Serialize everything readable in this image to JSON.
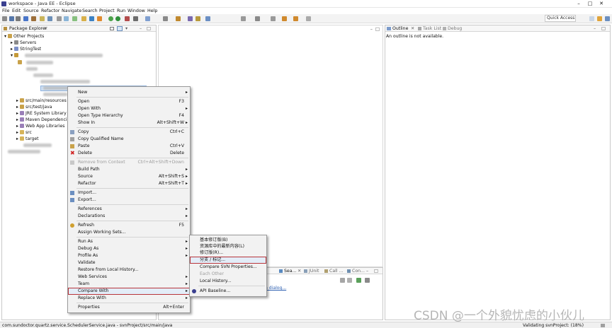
{
  "window": {
    "title": "workspace - Java EE - Eclipse"
  },
  "menubar": [
    "File",
    "Edit",
    "Source",
    "Refactor",
    "Navigate",
    "Search",
    "Project",
    "Run",
    "Window",
    "Help"
  ],
  "toolbar": {
    "quick_access": "Quick Access"
  },
  "package_explorer": {
    "tab": "Package Explorer",
    "items": [
      "Other Projects",
      "Servers",
      "StringTest",
      "src/main/resources",
      "src/test/java",
      "JRE System Library",
      "Maven Dependencies",
      "Web App Libraries",
      "src",
      "target"
    ]
  },
  "outline": {
    "tabs": [
      "Outline",
      "Task List",
      "Debug"
    ],
    "message": "An outline is not available."
  },
  "bottom_panel": {
    "tabs": [
      "Sea...",
      "JUnit",
      "Call ...",
      "Con..."
    ],
    "link_fragment": "h dialog..."
  },
  "context_menu": [
    {
      "label": "New",
      "shortcut": "",
      "arrow": true
    },
    {
      "label": "Open",
      "shortcut": "F3"
    },
    {
      "label": "Open With",
      "arrow": true
    },
    {
      "label": "Open Type Hierarchy",
      "shortcut": "F4"
    },
    {
      "label": "Show In",
      "shortcut": "Alt+Shift+W",
      "arrow": true
    },
    {
      "label": "Copy",
      "shortcut": "Ctrl+C"
    },
    {
      "label": "Copy Qualified Name"
    },
    {
      "label": "Paste",
      "shortcut": "Ctrl+V"
    },
    {
      "label": "Delete",
      "shortcut": "Delete"
    },
    {
      "label": "Remove from Context",
      "shortcut": "Ctrl+Alt+Shift+Down",
      "disabled": true
    },
    {
      "label": "Build Path",
      "arrow": true
    },
    {
      "label": "Source",
      "shortcut": "Alt+Shift+S",
      "arrow": true
    },
    {
      "label": "Refactor",
      "shortcut": "Alt+Shift+T",
      "arrow": true
    },
    {
      "label": "Import..."
    },
    {
      "label": "Export..."
    },
    {
      "label": "References",
      "arrow": true
    },
    {
      "label": "Declarations",
      "arrow": true
    },
    {
      "label": "Refresh",
      "shortcut": "F5"
    },
    {
      "label": "Assign Working Sets..."
    },
    {
      "label": "Run As",
      "arrow": true
    },
    {
      "label": "Debug As",
      "arrow": true
    },
    {
      "label": "Profile As",
      "arrow": true
    },
    {
      "label": "Validate"
    },
    {
      "label": "Restore from Local History..."
    },
    {
      "label": "Web Services",
      "arrow": true
    },
    {
      "label": "Team",
      "arrow": true
    },
    {
      "label": "Compare With",
      "arrow": true,
      "highlighted": true
    },
    {
      "label": "Replace With",
      "arrow": true
    },
    {
      "label": "Properties",
      "shortcut": "Alt+Enter"
    }
  ],
  "submenu": [
    {
      "label": "基本修订版(B)"
    },
    {
      "label": "资源库中的最新内容(L)"
    },
    {
      "label": "修订版(R)..."
    },
    {
      "label": "分支 / 标记...",
      "highlighted": true
    },
    {
      "label": "Compare SVN Properties..."
    },
    {
      "label": "Each Other",
      "disabled": true
    },
    {
      "label": "Local History..."
    },
    {
      "label": "API Baseline..."
    }
  ],
  "status": {
    "left": "com.sundoctor.quartz.service.SchedulerService.java - svnProject/src/main/java",
    "right": "Validating svnProject: (18%)"
  },
  "watermark": "CSDN @一个外貌忧虑的小伙儿"
}
